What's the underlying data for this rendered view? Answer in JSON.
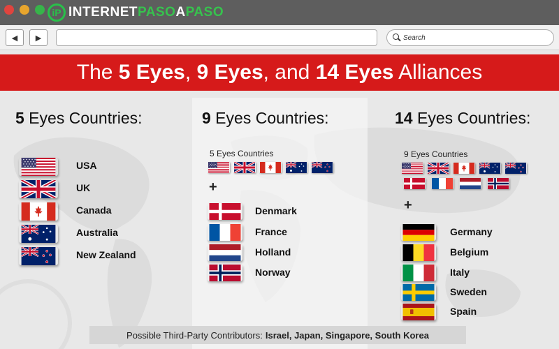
{
  "browser": {
    "logo_text_a": "INTERNET",
    "logo_text_b": "PASO",
    "logo_text_c": "A",
    "logo_text_d": "PASO",
    "logo_mark": "iP",
    "back_icon": "back-arrow-icon",
    "forward_icon": "forward-arrow-icon",
    "search_placeholder": "Search",
    "colors": {
      "close": "#e0443e",
      "minimize": "#e8a52d",
      "maximize": "#37b44a",
      "brand_green": "#37c24e"
    }
  },
  "banner": {
    "pre": "The ",
    "part1": "5 Eyes",
    "sep1": ", ",
    "part2": "9 Eyes",
    "sep2": ", and ",
    "part3": "14 Eyes",
    "post": " Alliances",
    "color": "#d61a1a"
  },
  "five_eyes": {
    "title_num": "5",
    "title_rest": " Eyes Countries:",
    "countries": [
      "USA",
      "UK",
      "Canada",
      "Australia",
      "New Zealand"
    ]
  },
  "nine_eyes": {
    "title_num": "9",
    "title_rest": " Eyes Countries:",
    "sub_label": "5 Eyes  Countries",
    "plus": "+",
    "countries": [
      "Denmark",
      "France",
      "Holland",
      "Norway"
    ]
  },
  "fourteen_eyes": {
    "title_num": "14",
    "title_rest": " Eyes Countries:",
    "sub_label": "9 Eyes  Countries",
    "plus": "+",
    "countries": [
      "Germany",
      "Belgium",
      "Italy",
      "Sweden",
      "Spain"
    ]
  },
  "footer": {
    "label": "Possible Third-Party Contributors:",
    "value": "Israel, Japan, Singapore, South Korea"
  }
}
